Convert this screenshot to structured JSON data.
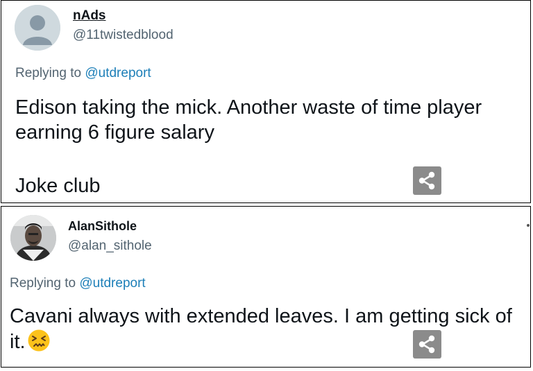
{
  "tweets": [
    {
      "name": "nAds",
      "handle": "@11twistedblood",
      "reply_prefix": "Replying to",
      "reply_mention": "@utdreport",
      "body": "Edison taking the mick. Another waste of time player earning 6 figure salary",
      "body_extra": "Joke club",
      "avatar_icon": "default-profile-icon"
    },
    {
      "name": "AlanSithole",
      "handle": "@alan_sithole",
      "reply_prefix": "Replying to",
      "reply_mention": "@utdreport",
      "body": "Cavani always with extended leaves. I am getting sick of it.",
      "emoji": "confounded-face-emoji",
      "avatar_icon": "user-photo"
    }
  ],
  "share_icon": "share-icon",
  "colors": {
    "mention": "#1d7fb8",
    "secondary": "#536471",
    "share_bg": "#8b8b8b"
  }
}
